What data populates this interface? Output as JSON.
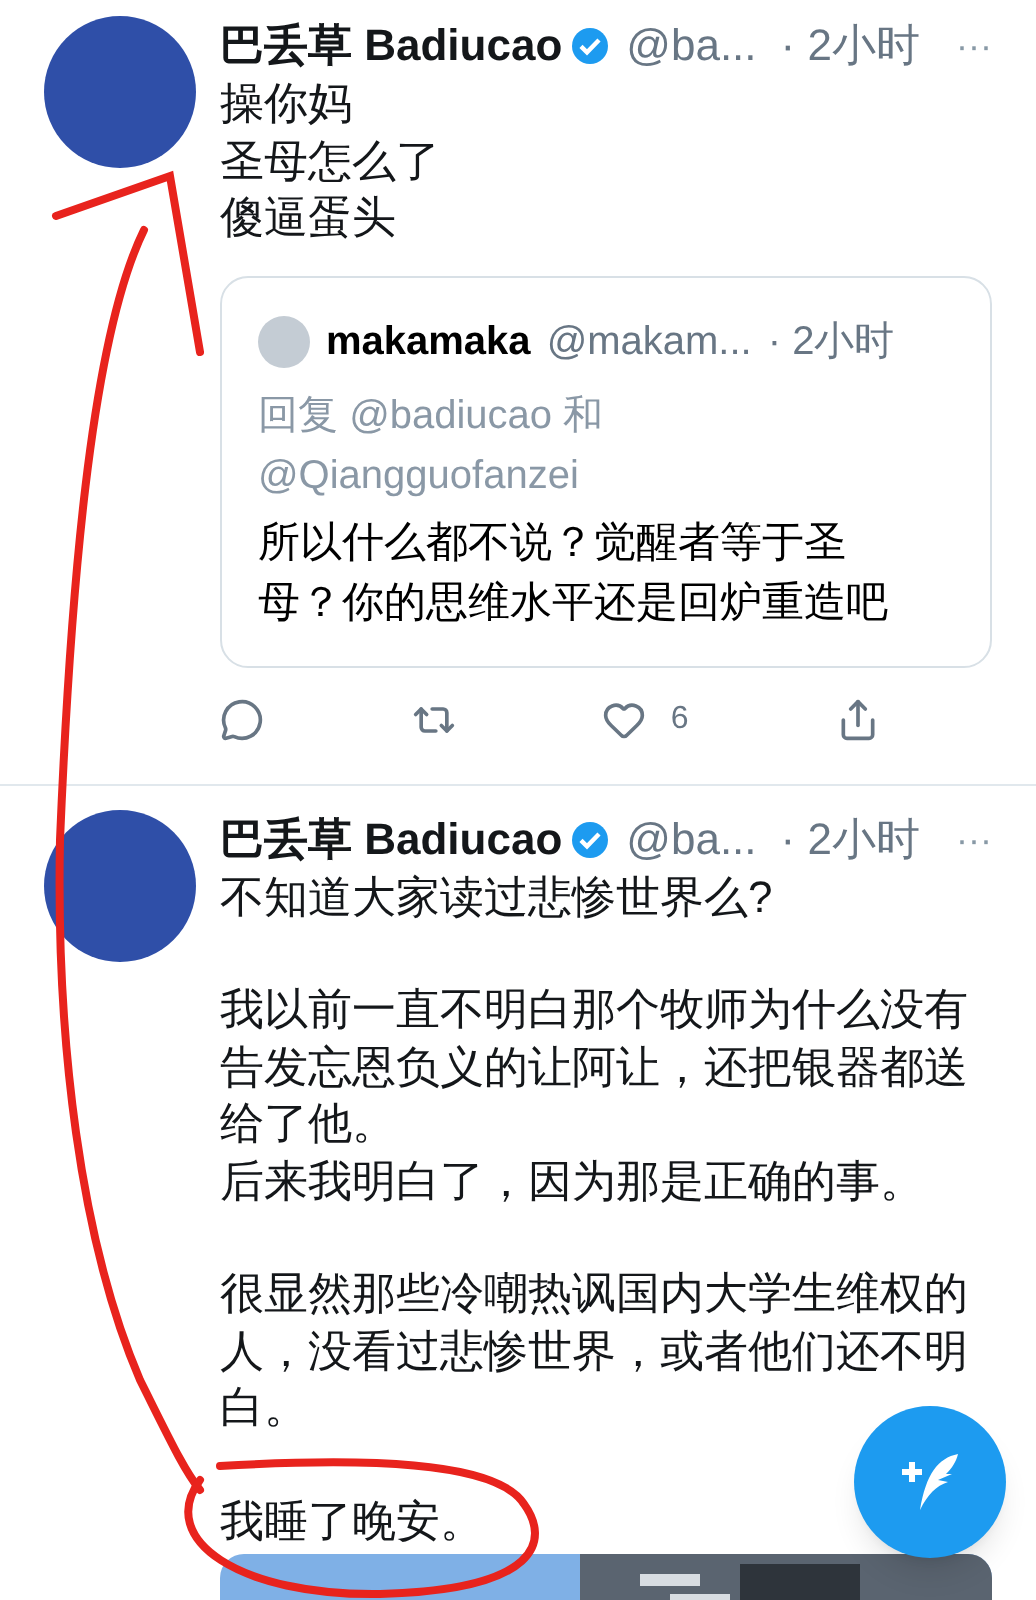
{
  "tweets": [
    {
      "name": "巴丢草 Badiucao",
      "handle": "@ba...",
      "time": "· 2小时",
      "more": "···",
      "body": [
        [
          "操你妈",
          "圣母怎么了",
          "傻逼蛋头"
        ]
      ],
      "quote": {
        "name": "makamaka",
        "handle": "@makam...",
        "time": "· 2小时",
        "reply_prefix": "回复",
        "reply_to": [
          "@badiucao",
          "和",
          "@Qiangguofanzei"
        ],
        "body": "所以什么都不说？觉醒者等于圣母？你的思维水平还是回炉重造吧"
      },
      "actions": {
        "likes": "6"
      }
    },
    {
      "name": "巴丢草 Badiucao",
      "handle": "@ba...",
      "time": "· 2小时",
      "more": "···",
      "body": [
        [
          "不知道大家读过悲惨世界么?"
        ],
        [
          "我以前一直不明白那个牧师为什么没有告发忘恩负义的让阿让，还把银器都送给了他。",
          "后来我明白了，因为那是正确的事。"
        ],
        [
          "很显然那些冷嘲热讽国内大学生维权的人，没看过悲惨世界，或者他们还不明白。"
        ],
        [
          "我睡了晚安。"
        ]
      ],
      "media": {
        "kind": "picture"
      }
    }
  ]
}
